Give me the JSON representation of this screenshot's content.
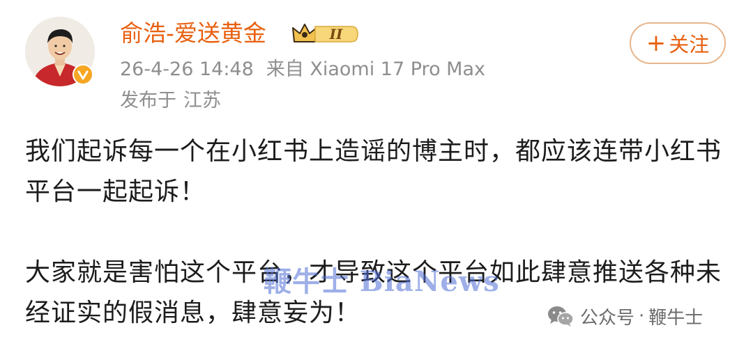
{
  "user": {
    "name": "俞浩-爱送黄金",
    "vip_level": "II"
  },
  "post": {
    "timestamp": "26-4-26 14:48",
    "source": "来自 Xiaomi 17 Pro Max",
    "location_label": "发布于",
    "location": "江苏",
    "paragraphs": [
      "我们起诉每一个在小红书上造谣的博主时，都应该连带小红书平台一起起诉！",
      "大家就是害怕这个平台，才导致这个平台如此肆意推送各种未经证实的假消息，肆意妄为！"
    ]
  },
  "actions": {
    "follow_plus": "+",
    "follow_label": "关注"
  },
  "overlays": {
    "watermark": "鞭牛士 BiaNews",
    "source_account_label": "公众号",
    "source_account_sep": "·",
    "source_account_name": "鞭牛士"
  },
  "colors": {
    "username": "#e8600f",
    "meta": "#8e8e8e",
    "follow_border": "#e7b58c",
    "body_text": "#1c1c1c",
    "watermark": "#4f6fd6",
    "vip_gold": "#f2c14e"
  },
  "icons": {
    "verified": "verified-badge-icon",
    "vip": "vip-crown-badge-icon",
    "wechat": "wechat-icon"
  }
}
